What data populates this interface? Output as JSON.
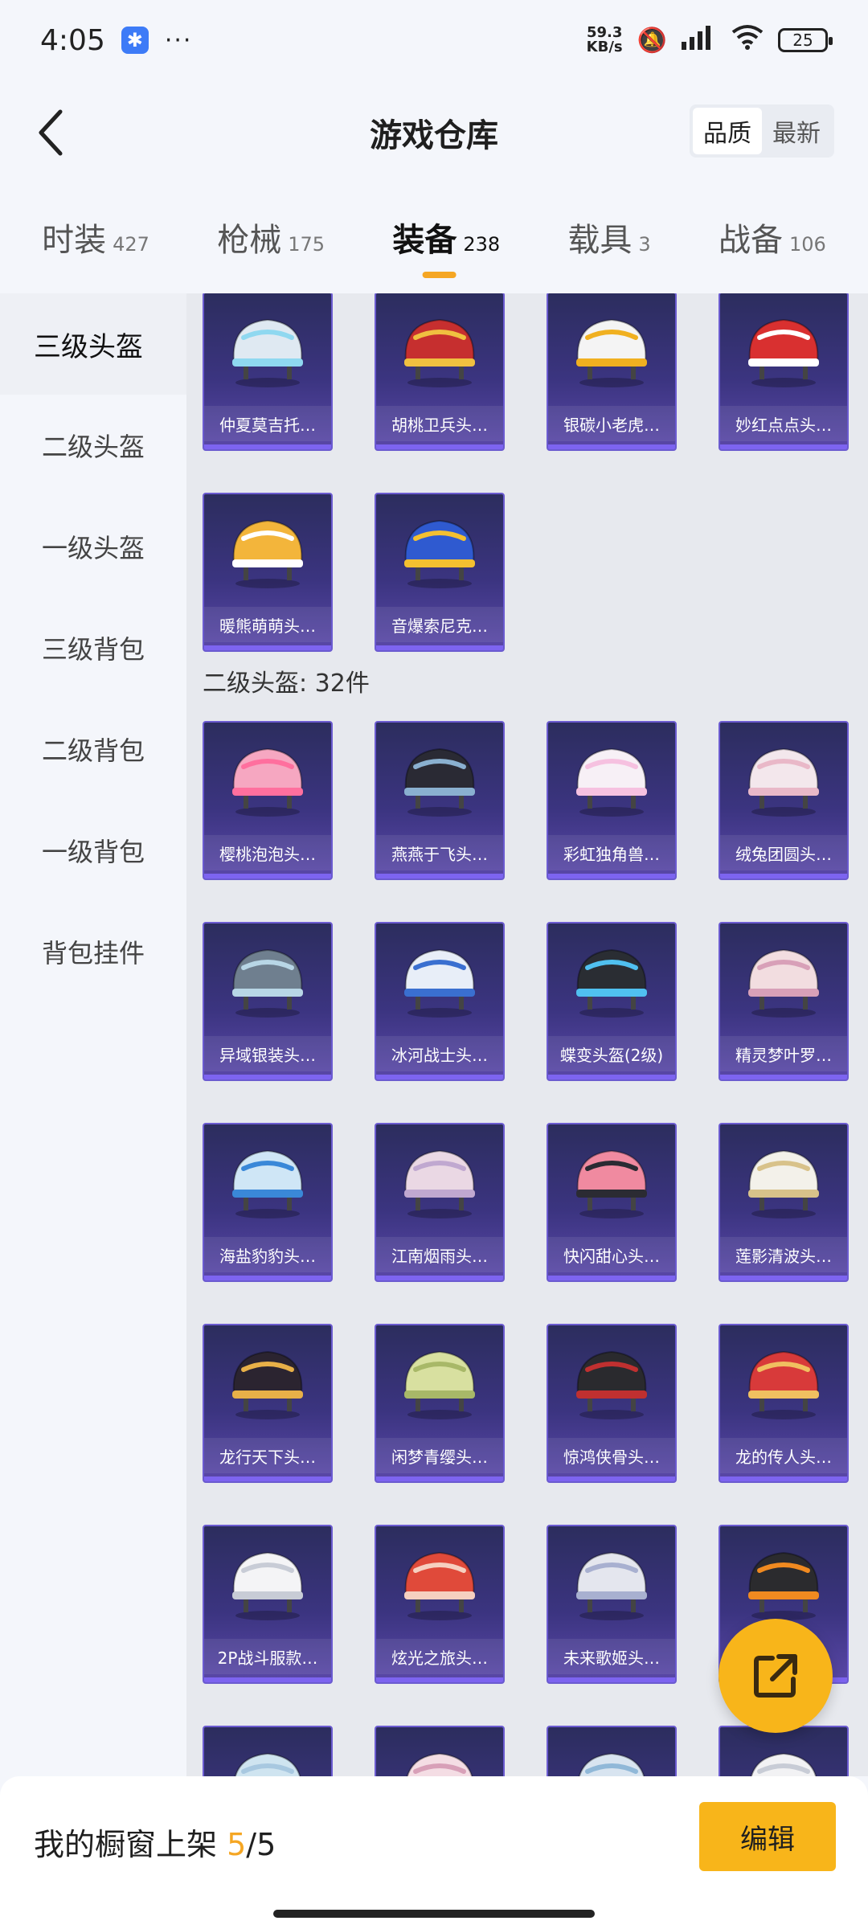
{
  "status_bar": {
    "time": "4:05",
    "dots": "···",
    "net_speed_value": "59.3",
    "net_speed_unit": "KB/s",
    "battery": "25"
  },
  "header": {
    "title": "游戏仓库",
    "sort_options": [
      "品质",
      "最新"
    ],
    "sort_active": "品质"
  },
  "tabs": [
    {
      "label": "时装",
      "count": "427"
    },
    {
      "label": "枪械",
      "count": "175"
    },
    {
      "label": "装备",
      "count": "238",
      "active": true
    },
    {
      "label": "载具",
      "count": "3"
    },
    {
      "label": "战备",
      "count": "106"
    }
  ],
  "sidebar": {
    "items": [
      "三级头盔",
      "二级头盔",
      "一级头盔",
      "三级背包",
      "二级背包",
      "一级背包",
      "背包挂件"
    ],
    "active": "三级头盔"
  },
  "level3_helmets": {
    "items": [
      {
        "name": "仲夏莫吉托…",
        "icon": "helmet-icon",
        "color": "#dfe9f2",
        "accent": "#8fd8f0"
      },
      {
        "name": "胡桃卫兵头…",
        "icon": "helmet-icon",
        "color": "#c62f2f",
        "accent": "#f0c040"
      },
      {
        "name": "银碳小老虎…",
        "icon": "helmet-icon",
        "color": "#f4f4f4",
        "accent": "#f0b020"
      },
      {
        "name": "妙红点点头…",
        "icon": "helmet-icon",
        "color": "#d93030",
        "accent": "#ffffff"
      },
      {
        "name": "暖熊萌萌头…",
        "icon": "helmet-icon",
        "color": "#f3b53b",
        "accent": "#ffffff"
      },
      {
        "name": "音爆索尼克…",
        "icon": "helmet-icon",
        "color": "#2f5ad0",
        "accent": "#f4c030"
      }
    ]
  },
  "level2_helmets": {
    "title": "二级头盔: 32件",
    "items": [
      {
        "name": "樱桃泡泡头…",
        "icon": "helmet-icon",
        "color": "#f6a7c1",
        "accent": "#ff6f9e"
      },
      {
        "name": "燕燕于飞头…",
        "icon": "helmet-icon",
        "color": "#2a2a34",
        "accent": "#8ab0d0"
      },
      {
        "name": "彩虹独角兽…",
        "icon": "helmet-icon",
        "color": "#f7f0f6",
        "accent": "#f6c1e0"
      },
      {
        "name": "绒兔团圆头…",
        "icon": "helmet-icon",
        "color": "#f3e7ec",
        "accent": "#e9b8c8"
      },
      {
        "name": "异域银装头…",
        "icon": "helmet-icon",
        "color": "#6f7f8f",
        "accent": "#b8d6e6"
      },
      {
        "name": "冰河战士头…",
        "icon": "helmet-icon",
        "color": "#e8eef8",
        "accent": "#3a6fd0"
      },
      {
        "name": "蝶变头盔(2级)",
        "icon": "helmet-icon",
        "color": "#2a2d33",
        "accent": "#50c0f0"
      },
      {
        "name": "精灵梦叶罗…",
        "icon": "helmet-icon",
        "color": "#f2dde0",
        "accent": "#d8a0b8"
      },
      {
        "name": "海盐豹豹头…",
        "icon": "helmet-icon",
        "color": "#cfe6f6",
        "accent": "#3a88d8"
      },
      {
        "name": "江南烟雨头…",
        "icon": "helmet-icon",
        "color": "#ead8e4",
        "accent": "#c0a8d0"
      },
      {
        "name": "快闪甜心头…",
        "icon": "helmet-icon",
        "color": "#f08aa0",
        "accent": "#2b2b33"
      },
      {
        "name": "莲影清波头…",
        "icon": "helmet-icon",
        "color": "#f3f1ea",
        "accent": "#d8c28a"
      },
      {
        "name": "龙行天下头…",
        "icon": "helmet-icon",
        "color": "#2b2430",
        "accent": "#e8b048"
      },
      {
        "name": "闲梦青缨头…",
        "icon": "helmet-icon",
        "color": "#d8e0a0",
        "accent": "#a8b868"
      },
      {
        "name": "惊鸿侠骨头…",
        "icon": "helmet-icon",
        "color": "#2a2a2e",
        "accent": "#c03030"
      },
      {
        "name": "龙的传人头…",
        "icon": "helmet-icon",
        "color": "#d83a3a",
        "accent": "#f0c060"
      },
      {
        "name": "2P战斗服款…",
        "icon": "helmet-icon",
        "color": "#f4f4f6",
        "accent": "#c8ccd6"
      },
      {
        "name": "炫光之旅头…",
        "icon": "helmet-icon",
        "color": "#e04a3a",
        "accent": "#f6d0c0"
      },
      {
        "name": "未来歌姬头…",
        "icon": "helmet-icon",
        "color": "#e4e6ee",
        "accent": "#a8b0d0"
      },
      {
        "name": "",
        "icon": "helmet-icon",
        "color": "#2b2b2e",
        "accent": "#f08a20"
      },
      {
        "name": "",
        "icon": "helmet-icon",
        "color": "#cfe4f0",
        "accent": "#a8c8e0"
      },
      {
        "name": "",
        "icon": "helmet-icon",
        "color": "#f4dde4",
        "accent": "#d8a0b8"
      },
      {
        "name": "",
        "icon": "helmet-icon",
        "color": "#d8e4f0",
        "accent": "#90b8d8"
      },
      {
        "name": "",
        "icon": "helmet-icon",
        "color": "#f2f2f4",
        "accent": "#c8ccd6"
      }
    ]
  },
  "fab": {
    "icon": "share-external-icon"
  },
  "bottom_bar": {
    "label": "我的橱窗上架",
    "count_current": "5",
    "count_total": "/5",
    "edit_label": "编辑"
  }
}
